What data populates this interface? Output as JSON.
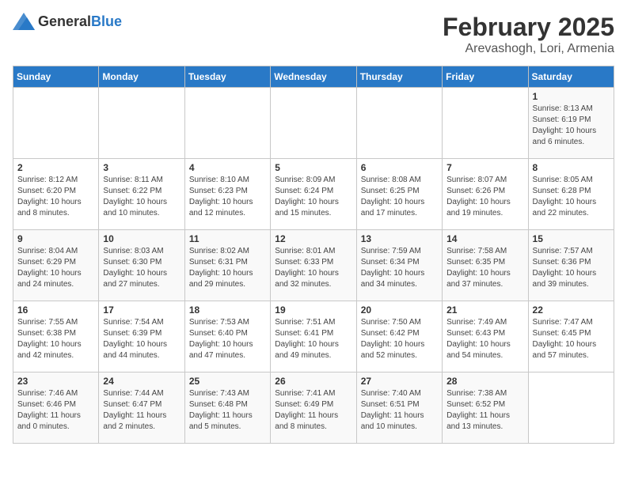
{
  "logo": {
    "general": "General",
    "blue": "Blue"
  },
  "title": "February 2025",
  "subtitle": "Arevashogh, Lori, Armenia",
  "weekdays": [
    "Sunday",
    "Monday",
    "Tuesday",
    "Wednesday",
    "Thursday",
    "Friday",
    "Saturday"
  ],
  "weeks": [
    [
      null,
      null,
      null,
      null,
      null,
      null,
      {
        "day": "1",
        "sunrise": "8:13 AM",
        "sunset": "6:19 PM",
        "daylight": "10 hours and 6 minutes."
      }
    ],
    [
      {
        "day": "2",
        "sunrise": "8:12 AM",
        "sunset": "6:20 PM",
        "daylight": "10 hours and 8 minutes."
      },
      {
        "day": "3",
        "sunrise": "8:11 AM",
        "sunset": "6:22 PM",
        "daylight": "10 hours and 10 minutes."
      },
      {
        "day": "4",
        "sunrise": "8:10 AM",
        "sunset": "6:23 PM",
        "daylight": "10 hours and 12 minutes."
      },
      {
        "day": "5",
        "sunrise": "8:09 AM",
        "sunset": "6:24 PM",
        "daylight": "10 hours and 15 minutes."
      },
      {
        "day": "6",
        "sunrise": "8:08 AM",
        "sunset": "6:25 PM",
        "daylight": "10 hours and 17 minutes."
      },
      {
        "day": "7",
        "sunrise": "8:07 AM",
        "sunset": "6:26 PM",
        "daylight": "10 hours and 19 minutes."
      },
      {
        "day": "8",
        "sunrise": "8:05 AM",
        "sunset": "6:28 PM",
        "daylight": "10 hours and 22 minutes."
      }
    ],
    [
      {
        "day": "9",
        "sunrise": "8:04 AM",
        "sunset": "6:29 PM",
        "daylight": "10 hours and 24 minutes."
      },
      {
        "day": "10",
        "sunrise": "8:03 AM",
        "sunset": "6:30 PM",
        "daylight": "10 hours and 27 minutes."
      },
      {
        "day": "11",
        "sunrise": "8:02 AM",
        "sunset": "6:31 PM",
        "daylight": "10 hours and 29 minutes."
      },
      {
        "day": "12",
        "sunrise": "8:01 AM",
        "sunset": "6:33 PM",
        "daylight": "10 hours and 32 minutes."
      },
      {
        "day": "13",
        "sunrise": "7:59 AM",
        "sunset": "6:34 PM",
        "daylight": "10 hours and 34 minutes."
      },
      {
        "day": "14",
        "sunrise": "7:58 AM",
        "sunset": "6:35 PM",
        "daylight": "10 hours and 37 minutes."
      },
      {
        "day": "15",
        "sunrise": "7:57 AM",
        "sunset": "6:36 PM",
        "daylight": "10 hours and 39 minutes."
      }
    ],
    [
      {
        "day": "16",
        "sunrise": "7:55 AM",
        "sunset": "6:38 PM",
        "daylight": "10 hours and 42 minutes."
      },
      {
        "day": "17",
        "sunrise": "7:54 AM",
        "sunset": "6:39 PM",
        "daylight": "10 hours and 44 minutes."
      },
      {
        "day": "18",
        "sunrise": "7:53 AM",
        "sunset": "6:40 PM",
        "daylight": "10 hours and 47 minutes."
      },
      {
        "day": "19",
        "sunrise": "7:51 AM",
        "sunset": "6:41 PM",
        "daylight": "10 hours and 49 minutes."
      },
      {
        "day": "20",
        "sunrise": "7:50 AM",
        "sunset": "6:42 PM",
        "daylight": "10 hours and 52 minutes."
      },
      {
        "day": "21",
        "sunrise": "7:49 AM",
        "sunset": "6:43 PM",
        "daylight": "10 hours and 54 minutes."
      },
      {
        "day": "22",
        "sunrise": "7:47 AM",
        "sunset": "6:45 PM",
        "daylight": "10 hours and 57 minutes."
      }
    ],
    [
      {
        "day": "23",
        "sunrise": "7:46 AM",
        "sunset": "6:46 PM",
        "daylight": "11 hours and 0 minutes."
      },
      {
        "day": "24",
        "sunrise": "7:44 AM",
        "sunset": "6:47 PM",
        "daylight": "11 hours and 2 minutes."
      },
      {
        "day": "25",
        "sunrise": "7:43 AM",
        "sunset": "6:48 PM",
        "daylight": "11 hours and 5 minutes."
      },
      {
        "day": "26",
        "sunrise": "7:41 AM",
        "sunset": "6:49 PM",
        "daylight": "11 hours and 8 minutes."
      },
      {
        "day": "27",
        "sunrise": "7:40 AM",
        "sunset": "6:51 PM",
        "daylight": "11 hours and 10 minutes."
      },
      {
        "day": "28",
        "sunrise": "7:38 AM",
        "sunset": "6:52 PM",
        "daylight": "11 hours and 13 minutes."
      },
      null
    ]
  ]
}
